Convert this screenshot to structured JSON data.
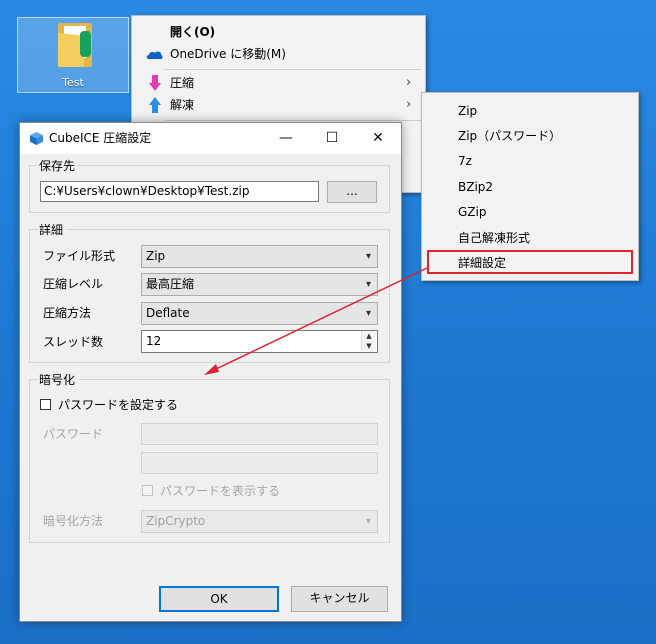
{
  "desktop": {
    "icon_label": "Test"
  },
  "context_menu": {
    "items": [
      {
        "label": "開く(O)",
        "bold": true
      },
      {
        "label": "OneDrive に移動(M)",
        "icon": "onedrive-icon"
      },
      {
        "label": "圧縮",
        "icon": "arrow-down-icon",
        "submenu": true
      },
      {
        "label": "解凍",
        "icon": "arrow-up-icon",
        "submenu": true
      }
    ],
    "chevron": "›"
  },
  "submenu": {
    "items": [
      "Zip",
      "Zip（パスワード）",
      "7z",
      "BZip2",
      "GZip",
      "自己解凍形式",
      "詳細設定"
    ],
    "highlighted": "詳細設定",
    "highlight_color": "#e0242b"
  },
  "dialog": {
    "title": "CubeICE 圧縮設定",
    "titlebar_buttons": {
      "minimize": "—",
      "maximize": "☐",
      "close": "✕"
    },
    "save_group": {
      "title": "保存先",
      "path": "C:¥Users¥clown¥Desktop¥Test.zip",
      "browse_label": "..."
    },
    "details_group": {
      "title": "詳細",
      "format_label": "ファイル形式",
      "format_value": "Zip",
      "level_label": "圧縮レベル",
      "level_value": "最高圧縮",
      "method_label": "圧縮方法",
      "method_value": "Deflate",
      "threads_label": "スレッド数",
      "threads_value": "12"
    },
    "encryption_group": {
      "title": "暗号化",
      "set_password_label": "パスワードを設定する",
      "set_password_checked": false,
      "password_label": "パスワード",
      "show_password_label": "パスワードを表示する",
      "method_label": "暗号化方法",
      "method_value": "ZipCrypto"
    },
    "ok_label": "OK",
    "cancel_label": "キャンセル",
    "accent_color": "#0078d7"
  },
  "annotation": {
    "arrow_color": "#e0242b"
  }
}
